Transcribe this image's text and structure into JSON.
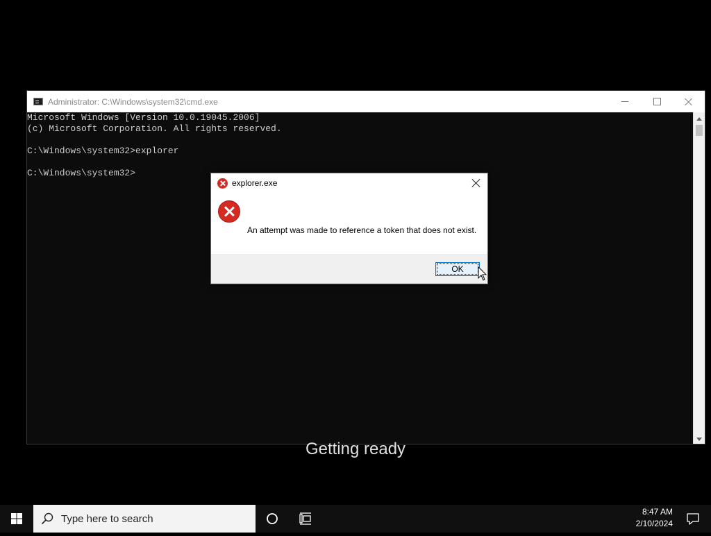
{
  "cmd_window": {
    "title": "Administrator: C:\\Windows\\system32\\cmd.exe",
    "console_lines": [
      "Microsoft Windows [Version 10.0.19045.2006]",
      "(c) Microsoft Corporation. All rights reserved.",
      "",
      "C:\\Windows\\system32>explorer",
      "",
      "C:\\Windows\\system32>"
    ]
  },
  "dialog": {
    "title": "explorer.exe",
    "message": "An attempt was made to reference a token that does not exist.",
    "ok_label": "OK",
    "icon": "error-icon"
  },
  "status": {
    "text": "Getting ready"
  },
  "taskbar": {
    "search_placeholder": "Type here to search",
    "time": "8:47 AM",
    "date": "2/10/2024",
    "icons": [
      "windows-logo-icon",
      "search-icon",
      "cortana-icon",
      "task-view-icon",
      "notification-icon"
    ]
  },
  "colors": {
    "console_bg": "#0c0c0c",
    "console_text": "#cccccc",
    "error_red": "#d42a21",
    "button_accent": "#0078d7",
    "taskbar_bg": "#101010"
  }
}
